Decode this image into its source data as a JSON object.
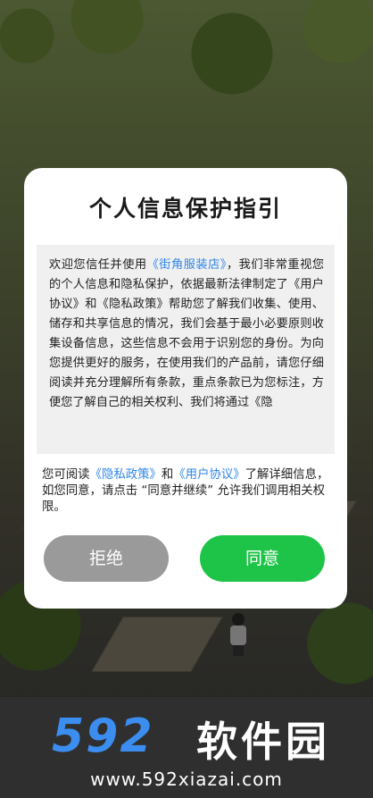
{
  "dialog": {
    "title": "个人信息保护指引",
    "body": {
      "intro": "欢迎您信任并使用",
      "app_link": "《街角服装店》",
      "after_app": "，我们非常重视您的个人信息和隐私保护，依据最新法律制定了《用户协议》和《隐私政策》帮助您了解我们收集、使用、储存和共享信息的情况，我们会基于最小必要原则收集设备信息，这些信息不会用于识别您的身份。为向您提供更好的服务，在使用我们的产品前，请您仔细阅读并充分理解所有条款，重点条款已为您标注，方便您了解自己的相关权利、我们将通过《隐"
    },
    "notice": {
      "prefix": "您可阅读",
      "privacy_link": "《隐私政策》",
      "and": "和",
      "user_link": "《用户协议》",
      "suffix": "了解详细信息，如您同意，请点击 “同意并继续” 允许我们调用相关权限。"
    },
    "refuse_label": "拒绝",
    "agree_label": "同意"
  },
  "watermark": {
    "number": "592",
    "name": "软件园",
    "url": "www.592xiazai.com"
  },
  "colors": {
    "link": "#2f86e8",
    "agree": "#1ec447",
    "refuse": "#9a9a9a"
  }
}
